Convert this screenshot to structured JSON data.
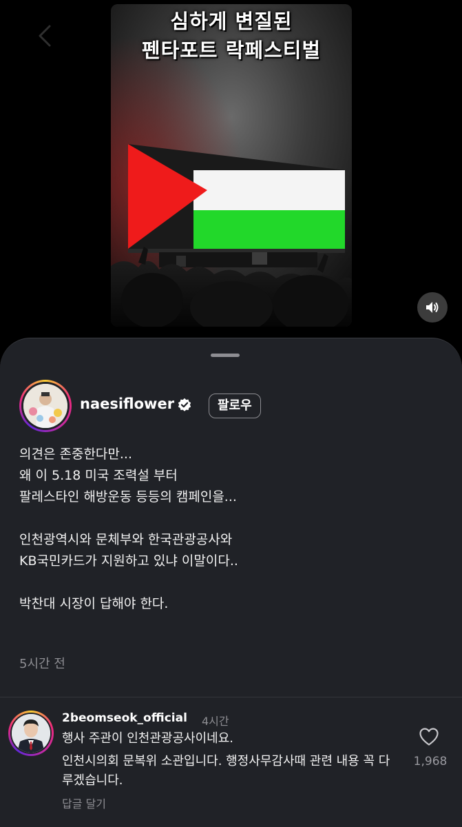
{
  "video": {
    "caption_line1": "심하게 변질된",
    "caption_line2": "펜타포트 락페스티벌",
    "flag_colors": {
      "black": "#1a1a1a",
      "white": "#f4f4f4",
      "green": "#22d82a",
      "red": "#ef1b1b"
    },
    "mute_icon": "speaker-icon"
  },
  "post": {
    "username": "naesiflower",
    "verified_icon": "verified-badge-icon",
    "follow_label": "팔로우",
    "caption": {
      "l1": "의견은 존중한다만...",
      "l2": "왜 이 5.18 미국 조력설 부터",
      "l3": "팔레스타인 해방운동 등등의 캠페인을...",
      "l4": "인천광역시와 문체부와 한국관광공사와",
      "l5": "KB국민카드가 지원하고 있냐 이말이다..",
      "l6": "박찬대 시장이 답해야 한다."
    },
    "time_ago": "5시간 전"
  },
  "comment": {
    "username": "2beomseok_official",
    "time": "4시간",
    "text1": "행사 주관이 인천관광공사이네요.",
    "text2": "인천시의회 문복위 소관입니다. 행정사무감사때 관련 내용 꼭 다루겠습니다.",
    "reply_label": "답글 달기",
    "like_count": "1,968",
    "like_icon": "heart-outline-icon"
  },
  "colors": {
    "sheet_bg": "#202227",
    "muted_text": "#8e8e93",
    "story_ring": [
      "#f9ce34",
      "#ee2a7b",
      "#6228d7"
    ]
  }
}
